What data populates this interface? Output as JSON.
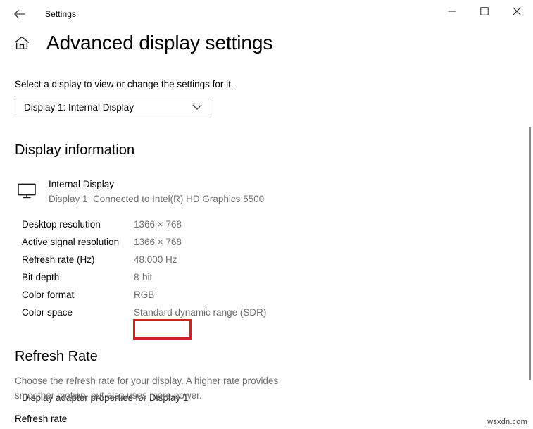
{
  "titlebar": {
    "back_label": "Back",
    "app_title": "Settings",
    "minimize_label": "Minimize",
    "maximize_label": "Maximize",
    "close_label": "Close"
  },
  "header": {
    "home_label": "Home",
    "page_title": "Advanced display settings"
  },
  "display_selector": {
    "label": "Select a display to view or change the settings for it.",
    "selected": "Display 1: Internal Display",
    "options": [
      "Display 1: Internal Display"
    ]
  },
  "display_information": {
    "heading": "Display information",
    "device_name": "Internal Display",
    "device_sub": "Display 1: Connected to Intel(R) HD Graphics 5500",
    "rows": [
      {
        "key": "Desktop resolution",
        "value": "1366 × 768",
        "highlighted": false
      },
      {
        "key": "Active signal resolution",
        "value": "1366 × 768",
        "highlighted": false
      },
      {
        "key": "Refresh rate (Hz)",
        "value": "48.000 Hz",
        "highlighted": true
      },
      {
        "key": "Bit depth",
        "value": "8-bit",
        "highlighted": false
      },
      {
        "key": "Color format",
        "value": "RGB",
        "highlighted": false
      },
      {
        "key": "Color space",
        "value": "Standard dynamic range (SDR)",
        "highlighted": false
      }
    ],
    "adapter_link": "Display adapter properties for Display 1"
  },
  "refresh_rate_section": {
    "heading": "Refresh Rate",
    "description": "Choose the refresh rate for your display. A higher rate provides smoother motion, but also uses more power.",
    "field_label": "Refresh rate"
  },
  "watermark": "wsxdn.com",
  "colors": {
    "highlight_border": "#d42027",
    "value_text": "#6e6e6e",
    "primary_text": "#000000",
    "combo_border": "#9a9a9a",
    "scrollbar_thumb": "#8a8a8a",
    "background": "#ffffff"
  }
}
